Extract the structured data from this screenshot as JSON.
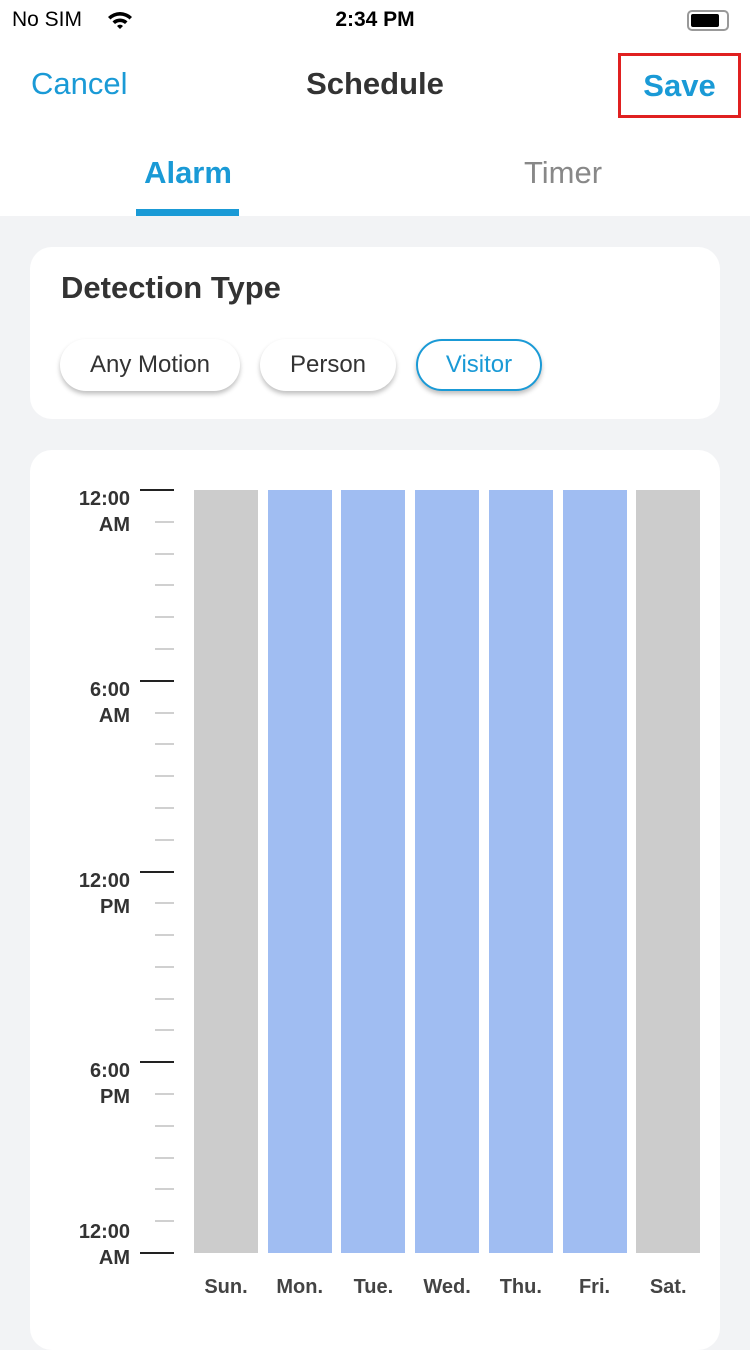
{
  "status_bar": {
    "carrier": "No SIM",
    "time": "2:34 PM"
  },
  "nav": {
    "cancel": "Cancel",
    "title": "Schedule",
    "save": "Save"
  },
  "tabs": [
    {
      "label": "Alarm",
      "active": true
    },
    {
      "label": "Timer",
      "active": false
    }
  ],
  "detection": {
    "title": "Detection Type",
    "options": [
      {
        "label": "Any Motion",
        "selected": false
      },
      {
        "label": "Person",
        "selected": false
      },
      {
        "label": "Visitor",
        "selected": true
      }
    ]
  },
  "colors": {
    "accent": "#1a9ad6",
    "active_day": "#a0bdf2",
    "inactive_day": "#cccccc",
    "highlight": "#e02020"
  },
  "schedule": {
    "y_labels": [
      [
        "12:00",
        "AM"
      ],
      [
        "6:00",
        "AM"
      ],
      [
        "12:00",
        "PM"
      ],
      [
        "6:00",
        "PM"
      ],
      [
        "12:00",
        "AM"
      ]
    ],
    "days": [
      {
        "label": "Sun.",
        "active": false
      },
      {
        "label": "Mon.",
        "active": true
      },
      {
        "label": "Tue.",
        "active": true
      },
      {
        "label": "Wed.",
        "active": true
      },
      {
        "label": "Thu.",
        "active": true
      },
      {
        "label": "Fri.",
        "active": true
      },
      {
        "label": "Sat.",
        "active": false
      }
    ]
  }
}
